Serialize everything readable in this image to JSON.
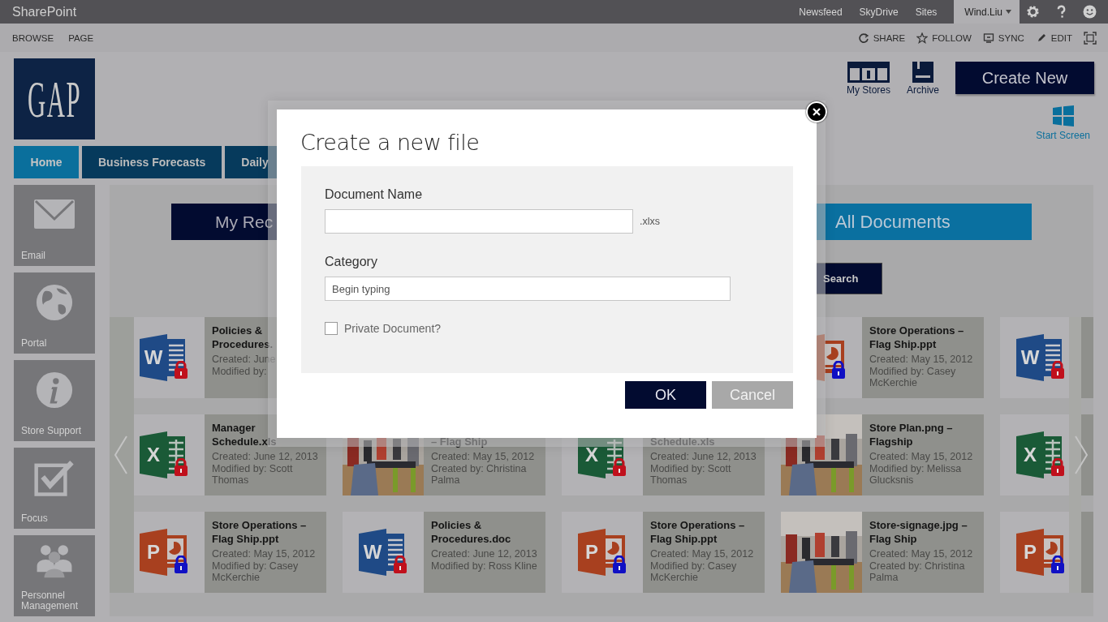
{
  "suite_bar": {
    "brand": "SharePoint",
    "links": [
      "Newsfeed",
      "SkyDrive",
      "Sites"
    ],
    "user": "Wind.Liu"
  },
  "ribbon": {
    "tabs": [
      "BROWSE",
      "PAGE"
    ],
    "actions": [
      {
        "label": "SHARE",
        "kind": "share"
      },
      {
        "label": "FOLLOW",
        "kind": "follow"
      },
      {
        "label": "SYNC",
        "kind": "sync"
      },
      {
        "label": "EDIT",
        "kind": "edit"
      }
    ]
  },
  "logo": "GAP",
  "nav_tabs": [
    {
      "label": "Home",
      "selected": true
    },
    {
      "label": "Business Forecasts",
      "selected": false
    },
    {
      "label": "Daily",
      "selected": false
    }
  ],
  "header_actions": [
    {
      "label": "My Stores",
      "kind": "stores"
    },
    {
      "label": "Archive",
      "kind": "archive"
    }
  ],
  "create_button": "Create New",
  "start_screen": "Start Screen",
  "apps": [
    {
      "label": "Email",
      "kind": "email"
    },
    {
      "label": "Portal",
      "kind": "globe"
    },
    {
      "label": "Store Support",
      "kind": "info"
    },
    {
      "label": "Focus",
      "kind": "check"
    },
    {
      "label": "Personnel Management",
      "kind": "people"
    }
  ],
  "views": [
    {
      "label": "My Rec",
      "selected": false
    },
    {
      "label": "All Documents",
      "selected": true
    }
  ],
  "search_button": "Search",
  "tiles": [
    [
      {
        "kind": "word",
        "letter": "W",
        "color": "#c0101c",
        "title": "Policies &\nProcedures.",
        "meta": [
          "Created: June",
          "Modified by:"
        ]
      },
      {
        "kind": "covered"
      },
      {
        "kind": "covered"
      },
      {
        "kind": "powerpoint",
        "color": "#1010c4",
        "title": "Store Operations – Flag Ship.ppt",
        "meta": [
          "Created: May 15, 2012",
          "Modified by: Casey McKerchie"
        ]
      },
      {
        "kind": "word",
        "letter": "W",
        "color": "#c0101c"
      }
    ],
    [
      {
        "kind": "excel",
        "letter": "X",
        "color": "#c0101c",
        "title": "Manager Schedule.xls",
        "meta": [
          "Created: June 12, 2013",
          "Modified by: Scott Thomas"
        ]
      },
      {
        "kind": "picture",
        "title_covered": true,
        "title": "– Flag Ship",
        "meta": [
          "Created: May 15, 2012",
          "Created by: Christina Palma"
        ]
      },
      {
        "kind": "excel",
        "letter": "X",
        "color": "#c0101c",
        "title_covered": true,
        "title": "Schedule.xls",
        "meta": [
          "Created: June 12, 2013",
          "Modified by: Scott Thomas"
        ]
      },
      {
        "kind": "picture",
        "title": "Store Plan.png – Flagship",
        "meta": [
          "Created: May 15, 2012",
          "Modified by: Melissa Glucksnis"
        ]
      },
      {
        "kind": "excel",
        "letter": "X",
        "color": "#c0101c"
      }
    ],
    [
      {
        "kind": "powerpoint",
        "letter": "P",
        "color": "#1010c4",
        "title": "Store Operations – Flag Ship.ppt",
        "meta": [
          "Created: May 15, 2012",
          "Modified by: Casey McKerchie"
        ]
      },
      {
        "kind": "word",
        "letter": "W",
        "color": "#c0101c",
        "title": "Policies & Procedures.doc",
        "meta": [
          "Created: June 12, 2013",
          "Modified by: Ross Kline"
        ]
      },
      {
        "kind": "powerpoint",
        "letter": "P",
        "color": "#1010c4",
        "title": "Store Operations – Flag Ship.ppt",
        "meta": [
          "Created: May 15, 2012",
          "Modified by: Casey McKerchie"
        ]
      },
      {
        "kind": "picture",
        "title": "Store-signage.jpg – Flag Ship",
        "meta": [
          "Created: May 15, 2012",
          "Created by: Christina Palma"
        ]
      },
      {
        "kind": "powerpoint",
        "letter": "P",
        "color": "#1010c4"
      }
    ]
  ],
  "dialog": {
    "title": "Create a new file",
    "fields": [
      {
        "label": "Document Name",
        "suffix": ".xlxs"
      },
      {
        "label": "Category",
        "placeholder": "Begin typing"
      }
    ],
    "private": {
      "label": "Private Document?",
      "checked": false
    },
    "buttons": [
      {
        "label": "OK",
        "kind": "primary"
      },
      {
        "label": "Cancel",
        "kind": "secondary"
      }
    ]
  }
}
